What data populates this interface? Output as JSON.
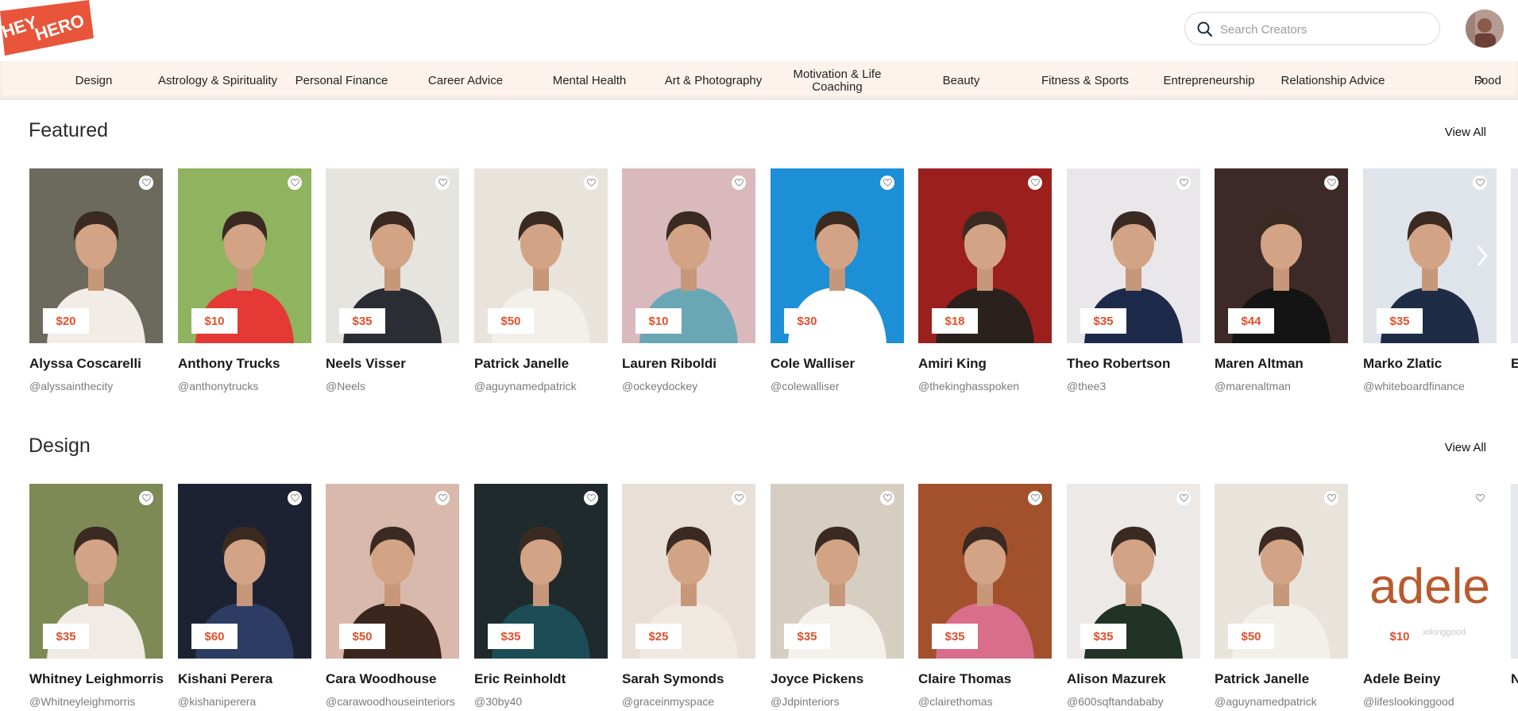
{
  "brand": {
    "logo_text_top": "HEY",
    "logo_text_bottom": "HERO",
    "color": "#e8553a"
  },
  "search": {
    "placeholder": "Search Creators"
  },
  "categories": [
    "Design",
    "Astrology & Spirituality",
    "Personal Finance",
    "Career Advice",
    "Mental Health",
    "Art & Photography",
    "Motivation & Life Coaching",
    "Beauty",
    "Fitness & Sports",
    "Entrepreneurship",
    "Relationship Advice",
    "Food"
  ],
  "featured": {
    "title": "Featured",
    "view_all": "View All",
    "cards": [
      {
        "name": "Alyssa Coscarelli",
        "handle": "@alyssainthecity",
        "price": "$20",
        "bg": "#6b6a5c",
        "accent": "#f2ece6"
      },
      {
        "name": "Anthony Trucks",
        "handle": "@anthonytrucks",
        "price": "$10",
        "bg": "#8fb35e",
        "accent": "#e53935"
      },
      {
        "name": "Neels Visser",
        "handle": "@Neels",
        "price": "$35",
        "bg": "#e6e4de",
        "accent": "#2b2d35"
      },
      {
        "name": "Patrick Janelle",
        "handle": "@aguynamedpatrick",
        "price": "$50",
        "bg": "#e8e4dc",
        "accent": "#f3f0ea"
      },
      {
        "name": "Lauren Riboldi",
        "handle": "@ockeydockey",
        "price": "$10",
        "bg": "#d9b9bb",
        "accent": "#6aa7b5"
      },
      {
        "name": "Cole Walliser",
        "handle": "@colewalliser",
        "price": "$30",
        "bg": "#1d8fd6",
        "accent": "#ffffff"
      },
      {
        "name": "Amiri King",
        "handle": "@thekinghasspoken",
        "price": "$18",
        "bg": "#9a1f1d",
        "accent": "#2a211c"
      },
      {
        "name": "Theo Robertson",
        "handle": "@thee3",
        "price": "$35",
        "bg": "#e9e7ea",
        "accent": "#1d2a4a"
      },
      {
        "name": "Maren Altman",
        "handle": "@marenaltman",
        "price": "$44",
        "bg": "#3d2a28",
        "accent": "#151415"
      },
      {
        "name": "Marko Zlatic",
        "handle": "@whiteboardfinance",
        "price": "$35",
        "bg": "#dfe4ea",
        "accent": "#1e2c45"
      }
    ],
    "partial_name": "E"
  },
  "design": {
    "title": "Design",
    "view_all": "View All",
    "cards": [
      {
        "name": "Whitney Leighmorris",
        "handle": "@Whitneyleighmorris",
        "price": "$35",
        "bg": "#7d8a55",
        "accent": "#f0ebe4"
      },
      {
        "name": "Kishani  Perera",
        "handle": "@kishaniperera",
        "price": "$60",
        "bg": "#1d2233",
        "accent": "#2d3c63"
      },
      {
        "name": "Cara Woodhouse",
        "handle": "@carawoodhouseinteriors",
        "price": "$50",
        "bg": "#d9b9ac",
        "accent": "#3a261d"
      },
      {
        "name": "Eric Reinholdt",
        "handle": "@30by40",
        "price": "$35",
        "bg": "#1f2a2c",
        "accent": "#1c4d57"
      },
      {
        "name": "Sarah Symonds",
        "handle": "@graceinmyspace",
        "price": "$25",
        "bg": "#e8e0d6",
        "accent": "#efe9e1"
      },
      {
        "name": "Joyce Pickens",
        "handle": "@Jdpinteriors",
        "price": "$35",
        "bg": "#d7cec2",
        "accent": "#f4f0ea"
      },
      {
        "name": "Claire Thomas",
        "handle": "@clairethomas",
        "price": "$35",
        "bg": "#a3512d",
        "accent": "#d86e8c"
      },
      {
        "name": "Alison Mazurek",
        "handle": "@600sqftandababy",
        "price": "$35",
        "bg": "#ece9e7",
        "accent": "#213327"
      },
      {
        "name": "Patrick Janelle",
        "handle": "@aguynamedpatrick",
        "price": "$50",
        "bg": "#e8e4dc",
        "accent": "#f3f0ea"
      },
      {
        "name": "Adele Beiny",
        "handle": "@lifeslookinggood",
        "price": "$10",
        "bg": "#ffffff",
        "accent": "#b95a2c",
        "logo_text": "adele",
        "logo_sub": "@lifeslookinggood"
      }
    ],
    "partial_name": "N"
  }
}
